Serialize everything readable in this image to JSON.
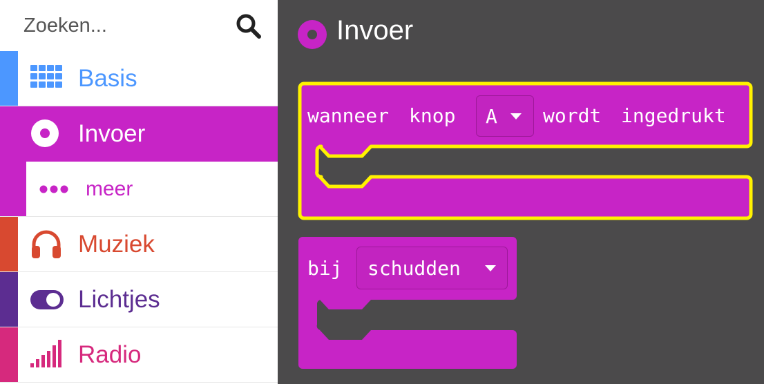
{
  "search": {
    "placeholder": "Zoeken..."
  },
  "sidebar": {
    "items": [
      {
        "label": "Basis",
        "color": "#4c97ff",
        "icon": "grid-icon"
      },
      {
        "label": "Invoer",
        "color": "#c724c6",
        "icon": "radio-button-icon",
        "selected": true
      },
      {
        "label": "meer",
        "color": "#c724c6",
        "icon": "more-dots-icon",
        "sub": true
      },
      {
        "label": "Muziek",
        "color": "#d84930",
        "icon": "headphones-icon"
      },
      {
        "label": "Lichtjes",
        "color": "#5c2d91",
        "icon": "toggle-icon"
      },
      {
        "label": "Radio",
        "color": "#d6297d",
        "icon": "signal-bars-icon"
      }
    ]
  },
  "workspace": {
    "title": "Invoer",
    "blocks": [
      {
        "words": [
          "wanneer",
          "knop",
          "wordt",
          "ingedrukt"
        ],
        "dropdown": "A",
        "highlighted": true
      },
      {
        "words": [
          "bij"
        ],
        "dropdown": "schudden",
        "highlighted": false
      }
    ]
  },
  "colors": {
    "input": "#c724c6",
    "workspace_bg": "#4b4a4b",
    "highlight": "#fff200"
  }
}
